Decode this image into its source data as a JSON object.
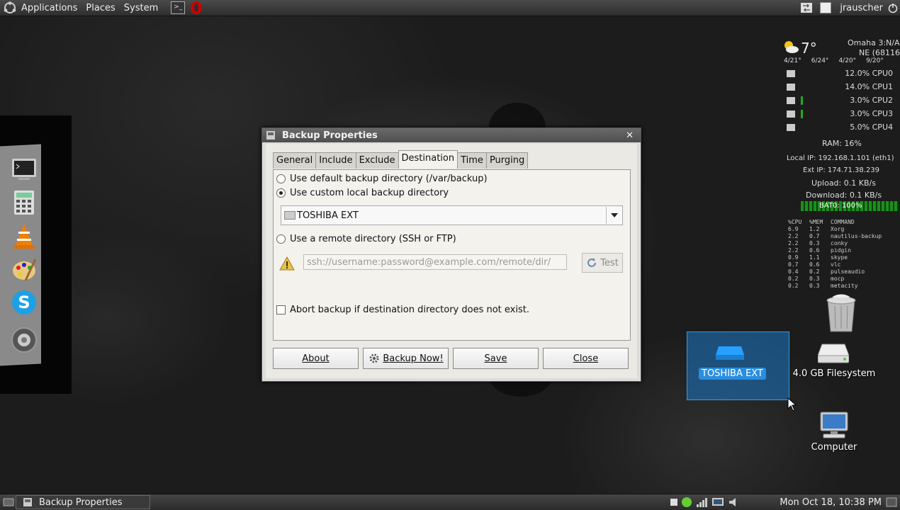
{
  "top_panel": {
    "menus": [
      "Applications",
      "Places",
      "System"
    ],
    "user": "jrauscher"
  },
  "weather": {
    "temperature": "7°",
    "location": "Omaha 3:N/A:",
    "wind": "NE (68116",
    "forecast": [
      "4/21°",
      "6/24°",
      "4/20°",
      "9/20°"
    ]
  },
  "system_monitor": {
    "cpus": [
      {
        "label": "12.0% CPU0"
      },
      {
        "label": "14.0% CPU1"
      },
      {
        "label": "3.0% CPU2"
      },
      {
        "label": "3.0% CPU3"
      },
      {
        "label": "5.0% CPU4"
      }
    ],
    "ram": "RAM: 16%",
    "local_ip": "Local IP: 192.168.1.101 (eth1)",
    "ext_ip": "Ext IP: 174.71.38.239",
    "upload": "Upload: 0.1 KB/s",
    "download": "Download: 0.1 KB/s",
    "battery": "BAT0: 100%",
    "process_header": [
      "%CPU",
      "%MEM",
      "COMMAND"
    ],
    "processes": [
      [
        "6.9",
        "1.2",
        "Xorg"
      ],
      [
        "2.2",
        "0.7",
        "nautilus-backup"
      ],
      [
        "2.2",
        "0.3",
        "conky"
      ],
      [
        "2.2",
        "0.6",
        "pidgin"
      ],
      [
        "0.9",
        "1.1",
        "skype"
      ],
      [
        "0.7",
        "0.6",
        "vlc"
      ],
      [
        "0.4",
        "0.2",
        "pulseaudio"
      ],
      [
        "0.2",
        "0.3",
        "mocp"
      ],
      [
        "0.2",
        "0.3",
        "metacity"
      ]
    ]
  },
  "dialog": {
    "title": "Backup Properties",
    "tabs": [
      "General",
      "Include",
      "Exclude",
      "Destination",
      "Time",
      "Purging"
    ],
    "active_tab": "Destination",
    "option_default": "Use default backup directory (/var/backup)",
    "option_custom": "Use custom local backup directory",
    "selected_drive": "TOSHIBA EXT",
    "option_remote": "Use a remote directory (SSH or FTP)",
    "remote_placeholder": "ssh://username:password@example.com/remote/dir/",
    "test_label": "Test",
    "abort_label": "Abort backup if destination directory does not exist.",
    "buttons": {
      "about": "About",
      "backup_now": "Backup Now!",
      "save": "Save",
      "close": "Close"
    }
  },
  "desktop_icons": {
    "toshiba": "TOSHIBA EXT",
    "filesystem": "4.0 GB Filesystem",
    "computer": "Computer"
  },
  "bottom_panel": {
    "task": "Backup Properties",
    "clock": "Mon Oct 18, 10:38 PM"
  }
}
